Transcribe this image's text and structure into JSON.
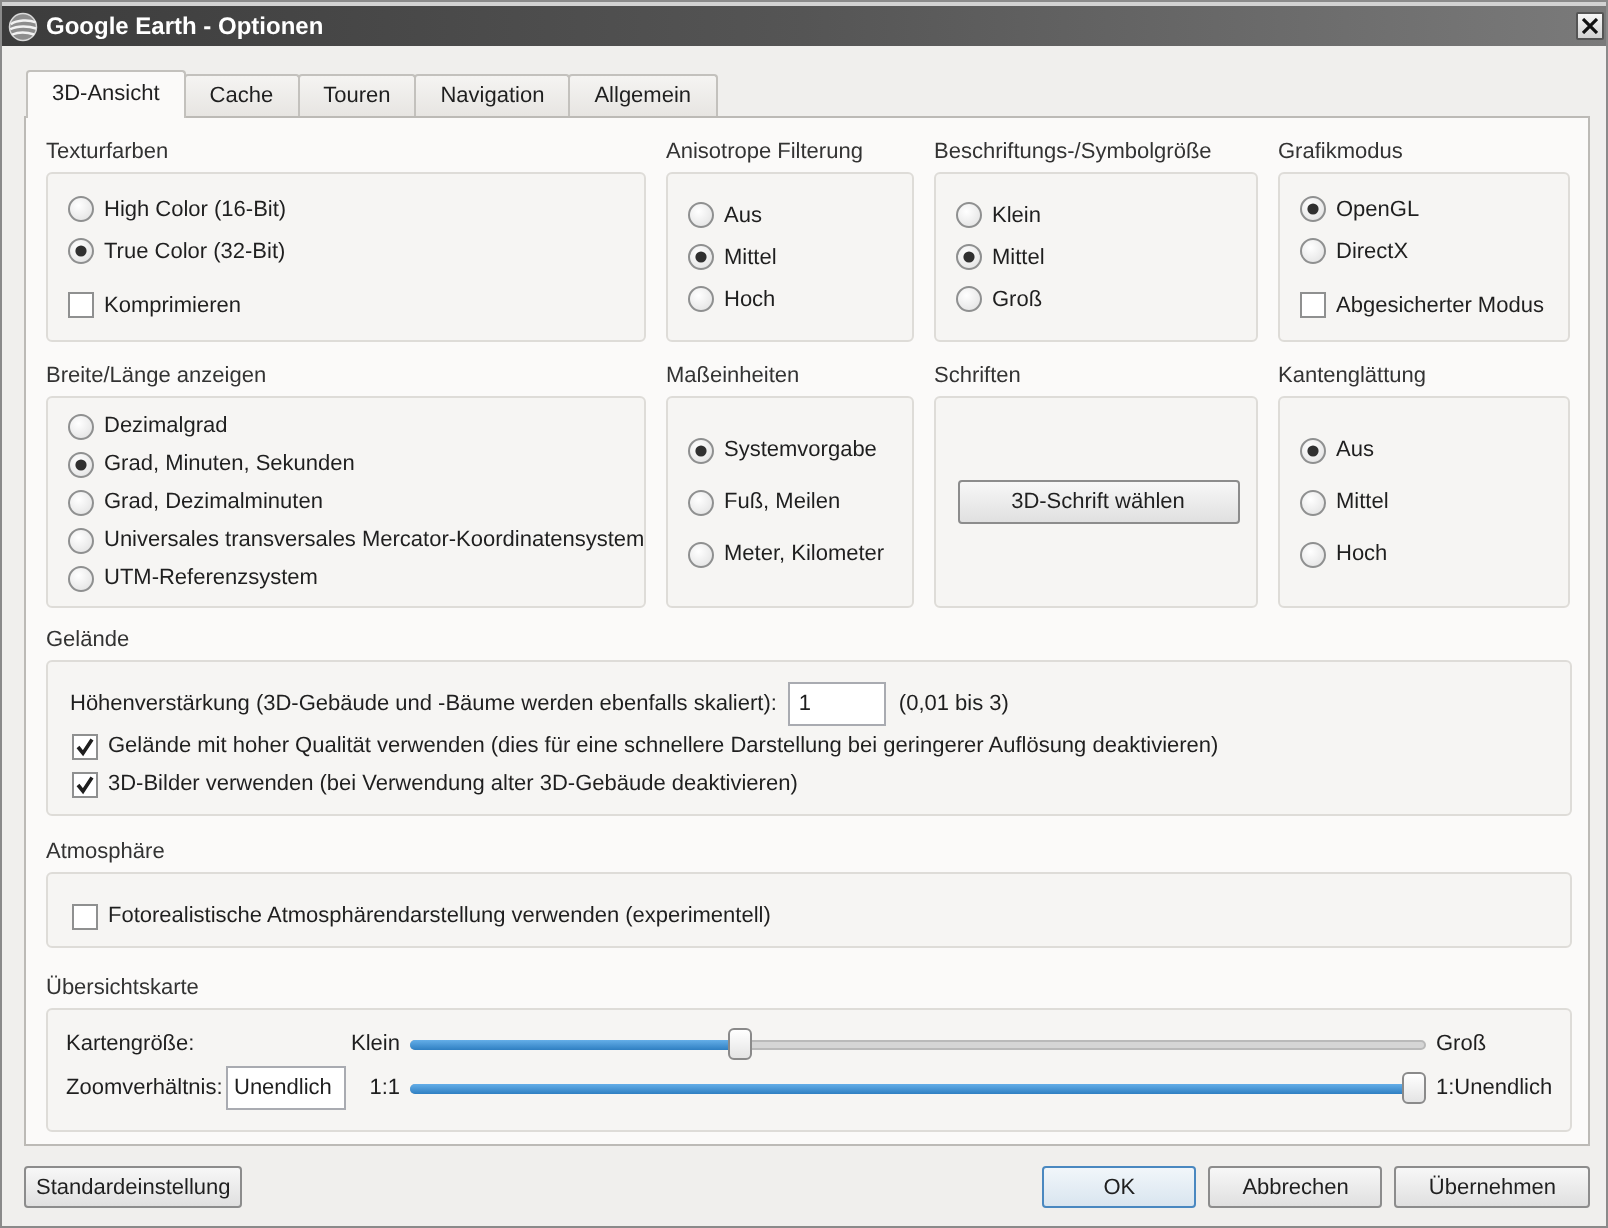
{
  "window": {
    "title": "Google Earth - Optionen"
  },
  "tabs": [
    {
      "label": "3D-Ansicht",
      "selected": true
    },
    {
      "label": "Cache",
      "selected": false
    },
    {
      "label": "Touren",
      "selected": false
    },
    {
      "label": "Navigation",
      "selected": false
    },
    {
      "label": "Allgemein",
      "selected": false
    }
  ],
  "group_rows": [
    [
      {
        "title": "Texturfarben",
        "options": [
          {
            "kind": "radio",
            "label": "High Color (16-Bit)",
            "checked": false
          },
          {
            "kind": "radio",
            "label": "True Color (32-Bit)",
            "checked": true
          },
          {
            "kind": "checkbox",
            "label": "Komprimieren",
            "checked": false
          }
        ]
      },
      {
        "title": "Anisotrope Filterung",
        "options": [
          {
            "kind": "radio",
            "label": "Aus",
            "checked": false
          },
          {
            "kind": "radio",
            "label": "Mittel",
            "checked": true
          },
          {
            "kind": "radio",
            "label": "Hoch",
            "checked": false
          }
        ]
      },
      {
        "title": "Beschriftungs-/Symbolgröße",
        "options": [
          {
            "kind": "radio",
            "label": "Klein",
            "checked": false
          },
          {
            "kind": "radio",
            "label": "Mittel",
            "checked": true
          },
          {
            "kind": "radio",
            "label": "Groß",
            "checked": false
          }
        ]
      },
      {
        "title": "Grafikmodus",
        "options": [
          {
            "kind": "radio",
            "label": "OpenGL",
            "checked": true
          },
          {
            "kind": "radio",
            "label": "DirectX",
            "checked": false
          },
          {
            "kind": "checkbox",
            "label": "Abgesicherter Modus",
            "checked": false
          }
        ]
      }
    ],
    [
      {
        "title": "Breite/Länge anzeigen",
        "options": [
          {
            "kind": "radio",
            "label": "Dezimalgrad",
            "checked": false
          },
          {
            "kind": "radio",
            "label": "Grad, Minuten, Sekunden",
            "checked": true
          },
          {
            "kind": "radio",
            "label": "Grad, Dezimalminuten",
            "checked": false
          },
          {
            "kind": "radio",
            "label": "Universales transversales Mercator-Koordinatensystem",
            "checked": false
          },
          {
            "kind": "radio",
            "label": "UTM-Referenzsystem",
            "checked": false
          }
        ]
      },
      {
        "title": "Maßeinheiten",
        "options": [
          {
            "kind": "radio",
            "label": "Systemvorgabe",
            "checked": true
          },
          {
            "kind": "radio",
            "label": "Fuß, Meilen",
            "checked": false
          },
          {
            "kind": "radio",
            "label": "Meter, Kilometer",
            "checked": false
          }
        ]
      },
      {
        "title": "Schriften",
        "options": [
          {
            "kind": "button",
            "label": "3D-Schrift wählen"
          }
        ]
      },
      {
        "title": "Kantenglättung",
        "options": [
          {
            "kind": "radio",
            "label": "Aus",
            "checked": true
          },
          {
            "kind": "radio",
            "label": "Mittel",
            "checked": false
          },
          {
            "kind": "radio",
            "label": "Hoch",
            "checked": false
          }
        ]
      }
    ]
  ],
  "terrain": {
    "title": "Gelände",
    "exaggeration": {
      "label": "Höhenverstärkung (3D-Gebäude und -Bäume werden ebenfalls skaliert):",
      "value": "1",
      "hint": "(0,01 bis 3)"
    },
    "options": [
      {
        "label": "Gelände mit hoher Qualität verwenden (dies für eine schnellere Darstellung bei geringerer Auflösung deaktivieren)",
        "checked": true
      },
      {
        "label": "3D-Bilder verwenden (bei Verwendung alter 3D-Gebäude deaktivieren)",
        "checked": true
      }
    ]
  },
  "atmosphere": {
    "title": "Atmosphäre",
    "options": [
      {
        "label": "Fotorealistische Atmosphärendarstellung verwenden (experimentell)",
        "checked": false
      }
    ]
  },
  "overview_map": {
    "title": "Übersichtskarte",
    "map_size": {
      "label": "Kartengröße:",
      "min_label": "Klein",
      "max_label": "Groß",
      "level": 0.32
    },
    "zoom_ratio": {
      "label": "Zoomverhältnis:",
      "value": "Unendlich",
      "min_label": "1:1",
      "max_label": "1:Unendlich",
      "level": 1.0
    }
  },
  "buttons": [
    {
      "label": "Standardeinstellung",
      "default": false
    },
    {
      "label": "OK",
      "default": true
    },
    {
      "label": "Abbrechen",
      "default": false
    },
    {
      "label": "Übernehmen",
      "default": false
    }
  ]
}
